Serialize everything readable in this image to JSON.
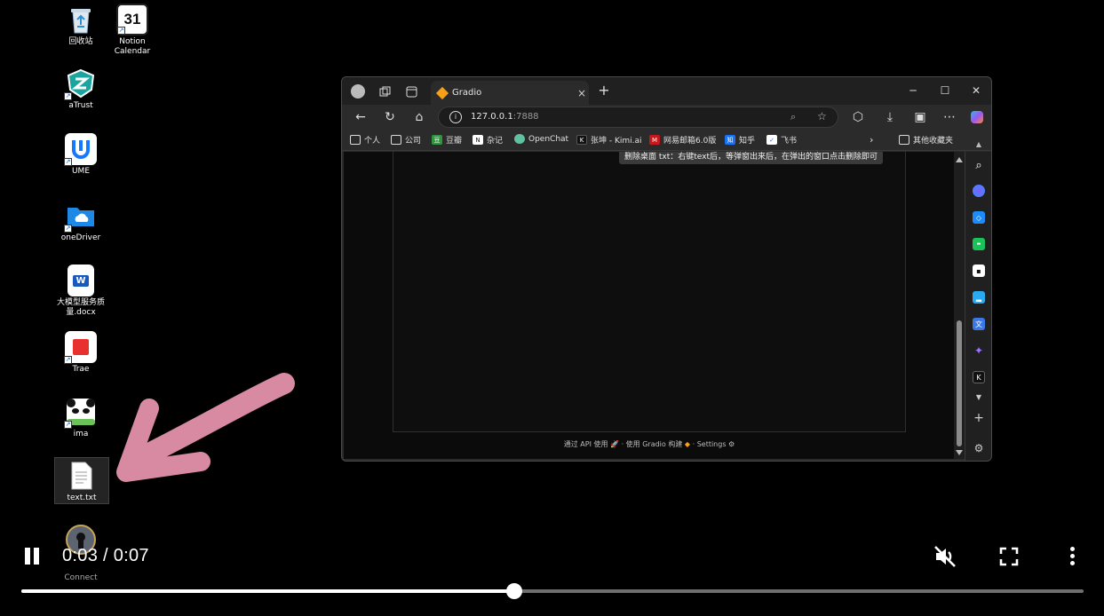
{
  "desktop": {
    "icons": [
      {
        "label": "回收站"
      },
      {
        "label": "Notion\nCalendar",
        "badge": "31"
      },
      {
        "label": "aTrust"
      },
      {
        "label": "UME"
      },
      {
        "label": "oneDriver"
      },
      {
        "label": "大模型服务质\n量.docx",
        "badge": "W"
      },
      {
        "label": "Trae"
      },
      {
        "label": "ima"
      },
      {
        "label": "text.txt"
      },
      {
        "label": "Connect"
      }
    ]
  },
  "browser": {
    "tab_title": "Gradio",
    "tab_close": "×",
    "new_tab": "+",
    "window": {
      "minimize": "─",
      "maximize": "☐",
      "close": "✕"
    },
    "url_host": "127.0.0.1",
    "url_port": ":7888",
    "bookmarks": [
      {
        "label": "个人"
      },
      {
        "label": "公司"
      },
      {
        "label": "豆瓣",
        "badge": "豆"
      },
      {
        "label": "杂记",
        "badge": "N"
      },
      {
        "label": "OpenChat"
      },
      {
        "label": "张坤 - Kimi.ai",
        "badge": "K"
      },
      {
        "label": "网易邮箱6.0版",
        "badge": "M"
      },
      {
        "label": "知乎",
        "badge": "知"
      },
      {
        "label": "飞书"
      },
      {
        "label": "其他收藏夹"
      }
    ],
    "tooltip": "删除桌面 txt：右键text后，等弹窗出来后，在弹出的窗口点击删除即可",
    "footer": {
      "api": "通过 API 使用",
      "sep": "·",
      "built": "使用 Gradio 构建",
      "settings": "Settings"
    },
    "sidebar_badge_k": "K"
  },
  "video": {
    "current_time": "0:03",
    "separator": "/",
    "duration": "0:07",
    "progress": 0.464
  },
  "colors": {
    "arrow": "#d98aa3",
    "page_bg": "#000000"
  }
}
